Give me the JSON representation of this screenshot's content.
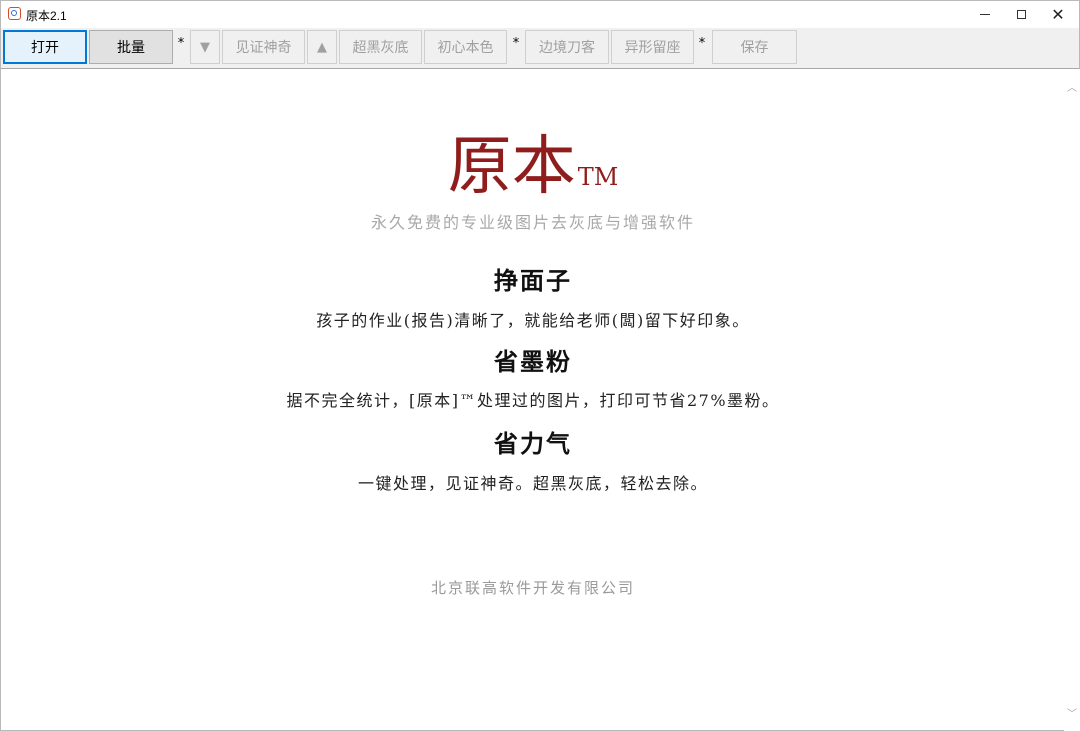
{
  "window": {
    "title": "原本2.1"
  },
  "toolbar": {
    "open_label": "打开",
    "batch_label": "批量",
    "sep": "*",
    "down_label": "▼",
    "witness_label": "见证神奇",
    "up_label": "▲",
    "superblack_label": "超黑灰底",
    "original_label": "初心本色",
    "border_label": "边境刀客",
    "shape_label": "异形留座",
    "save_label": "保存"
  },
  "content": {
    "brand": "原本",
    "brand_tm": "TM",
    "tagline": "永久免费的专业级图片去灰底与增强软件",
    "sections": [
      {
        "heading": "挣面子",
        "text": "孩子的作业(报告)清晰了，就能给老师(闆)留下好印象。"
      },
      {
        "heading": "省墨粉",
        "text": "据不完全统计，[原本]™处理过的图片，打印可节省27%墨粉。"
      },
      {
        "heading": "省力气",
        "text": "一键处理，见证神奇。超黑灰底，轻松去除。"
      }
    ],
    "company": "北京联高软件开发有限公司"
  },
  "colors": {
    "brand": "#8f1d1d",
    "accent": "#0078d7"
  }
}
